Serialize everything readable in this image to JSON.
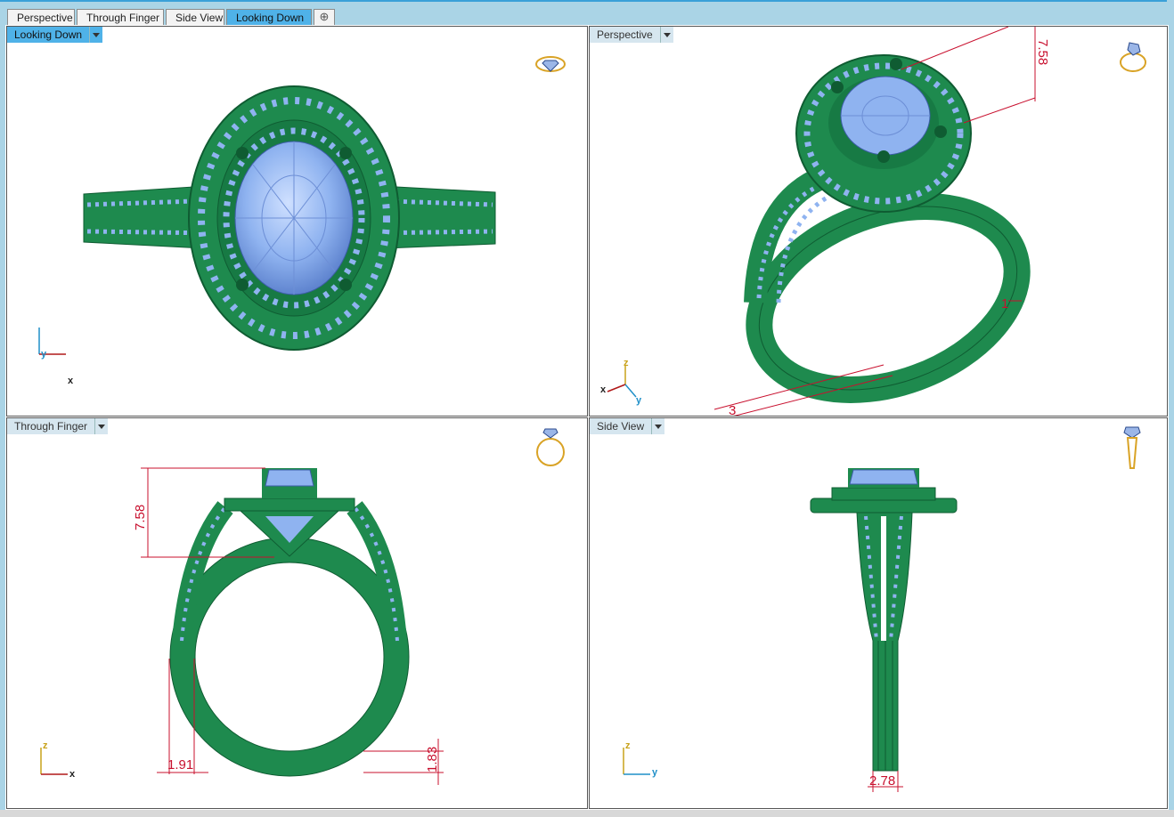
{
  "tabs": [
    {
      "label": "Perspective"
    },
    {
      "label": "Through Finger"
    },
    {
      "label": "Side View"
    },
    {
      "label": "Looking Down"
    }
  ],
  "viewports": {
    "top_left": {
      "label": "Looking Down",
      "axis_a": "y",
      "axis_b": "x"
    },
    "top_right": {
      "label": "Perspective",
      "axis_z": "z",
      "axis_x": "x",
      "axis_y": "y",
      "dim_height": "7.58",
      "dim_a": "1",
      "dim_b": "3"
    },
    "bottom_left": {
      "label": "Through Finger",
      "axis_z": "z",
      "axis_x": "x",
      "dim_height": "7.58",
      "dim_width": "1.91",
      "dim_thick": "1.83"
    },
    "bottom_right": {
      "label": "Side View",
      "axis_z": "z",
      "axis_y": "y",
      "dim_width": "2.78"
    }
  },
  "colors": {
    "metal": "#1e8a4e",
    "metal_dark": "#0f5c32",
    "gem": "#8fb3f0",
    "gem_light": "#b9d2ff",
    "dimension": "#c8102e",
    "active_tab": "#4fb2e8",
    "axis_y": "#1f8fc8",
    "axis_x": "#b01818",
    "axis_z": "#c8a21a"
  },
  "icons": [
    "ring-top-icon",
    "ring-perspective-icon",
    "ring-front-icon",
    "ring-side-icon",
    "add-tab-icon",
    "dropdown-icon"
  ]
}
